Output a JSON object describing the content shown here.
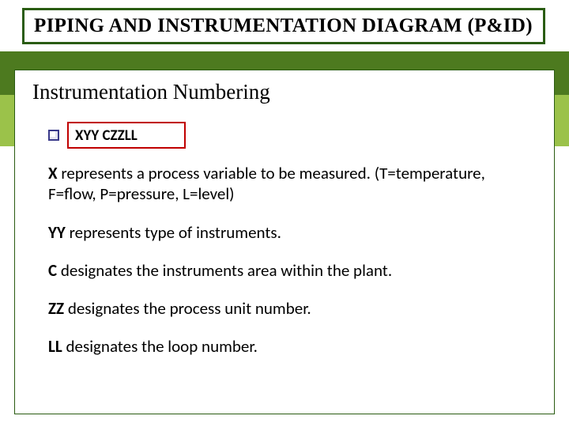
{
  "title": "PIPING AND INSTRUMENTATION DIAGRAM (P&ID)",
  "section_title": "Instrumentation Numbering",
  "code_format": "XYY CZZLL",
  "lines": {
    "l1_b": "X",
    "l1_rest": " represents a process variable to be measured. (T=temperature, F=flow, P=pressure, L=level)",
    "l2_b": "YY",
    "l2_rest": " represents type of instruments.",
    "l3_b": "C",
    "l3_rest": "   designates the instruments area within the plant.",
    "l4_b": "ZZ",
    "l4_rest": " designates the process unit number.",
    "l5_b": "LL",
    "l5_rest": "  designates the loop number."
  }
}
